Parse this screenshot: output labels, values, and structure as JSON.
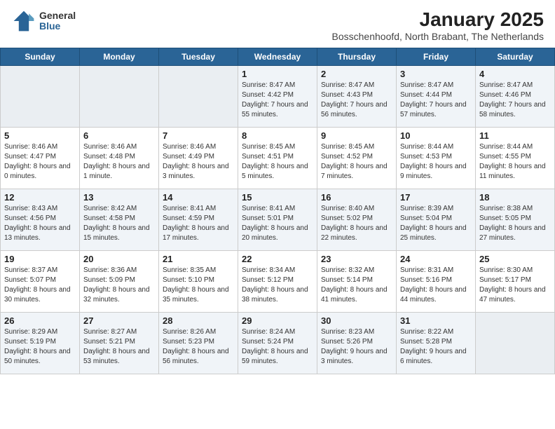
{
  "logo": {
    "general": "General",
    "blue": "Blue"
  },
  "title": "January 2025",
  "subtitle": "Bosschenhoofd, North Brabant, The Netherlands",
  "days_of_week": [
    "Sunday",
    "Monday",
    "Tuesday",
    "Wednesday",
    "Thursday",
    "Friday",
    "Saturday"
  ],
  "weeks": [
    [
      {
        "day": "",
        "info": ""
      },
      {
        "day": "",
        "info": ""
      },
      {
        "day": "",
        "info": ""
      },
      {
        "day": "1",
        "info": "Sunrise: 8:47 AM\nSunset: 4:42 PM\nDaylight: 7 hours and 55 minutes."
      },
      {
        "day": "2",
        "info": "Sunrise: 8:47 AM\nSunset: 4:43 PM\nDaylight: 7 hours and 56 minutes."
      },
      {
        "day": "3",
        "info": "Sunrise: 8:47 AM\nSunset: 4:44 PM\nDaylight: 7 hours and 57 minutes."
      },
      {
        "day": "4",
        "info": "Sunrise: 8:47 AM\nSunset: 4:46 PM\nDaylight: 7 hours and 58 minutes."
      }
    ],
    [
      {
        "day": "5",
        "info": "Sunrise: 8:46 AM\nSunset: 4:47 PM\nDaylight: 8 hours and 0 minutes."
      },
      {
        "day": "6",
        "info": "Sunrise: 8:46 AM\nSunset: 4:48 PM\nDaylight: 8 hours and 1 minute."
      },
      {
        "day": "7",
        "info": "Sunrise: 8:46 AM\nSunset: 4:49 PM\nDaylight: 8 hours and 3 minutes."
      },
      {
        "day": "8",
        "info": "Sunrise: 8:45 AM\nSunset: 4:51 PM\nDaylight: 8 hours and 5 minutes."
      },
      {
        "day": "9",
        "info": "Sunrise: 8:45 AM\nSunset: 4:52 PM\nDaylight: 8 hours and 7 minutes."
      },
      {
        "day": "10",
        "info": "Sunrise: 8:44 AM\nSunset: 4:53 PM\nDaylight: 8 hours and 9 minutes."
      },
      {
        "day": "11",
        "info": "Sunrise: 8:44 AM\nSunset: 4:55 PM\nDaylight: 8 hours and 11 minutes."
      }
    ],
    [
      {
        "day": "12",
        "info": "Sunrise: 8:43 AM\nSunset: 4:56 PM\nDaylight: 8 hours and 13 minutes."
      },
      {
        "day": "13",
        "info": "Sunrise: 8:42 AM\nSunset: 4:58 PM\nDaylight: 8 hours and 15 minutes."
      },
      {
        "day": "14",
        "info": "Sunrise: 8:41 AM\nSunset: 4:59 PM\nDaylight: 8 hours and 17 minutes."
      },
      {
        "day": "15",
        "info": "Sunrise: 8:41 AM\nSunset: 5:01 PM\nDaylight: 8 hours and 20 minutes."
      },
      {
        "day": "16",
        "info": "Sunrise: 8:40 AM\nSunset: 5:02 PM\nDaylight: 8 hours and 22 minutes."
      },
      {
        "day": "17",
        "info": "Sunrise: 8:39 AM\nSunset: 5:04 PM\nDaylight: 8 hours and 25 minutes."
      },
      {
        "day": "18",
        "info": "Sunrise: 8:38 AM\nSunset: 5:05 PM\nDaylight: 8 hours and 27 minutes."
      }
    ],
    [
      {
        "day": "19",
        "info": "Sunrise: 8:37 AM\nSunset: 5:07 PM\nDaylight: 8 hours and 30 minutes."
      },
      {
        "day": "20",
        "info": "Sunrise: 8:36 AM\nSunset: 5:09 PM\nDaylight: 8 hours and 32 minutes."
      },
      {
        "day": "21",
        "info": "Sunrise: 8:35 AM\nSunset: 5:10 PM\nDaylight: 8 hours and 35 minutes."
      },
      {
        "day": "22",
        "info": "Sunrise: 8:34 AM\nSunset: 5:12 PM\nDaylight: 8 hours and 38 minutes."
      },
      {
        "day": "23",
        "info": "Sunrise: 8:32 AM\nSunset: 5:14 PM\nDaylight: 8 hours and 41 minutes."
      },
      {
        "day": "24",
        "info": "Sunrise: 8:31 AM\nSunset: 5:16 PM\nDaylight: 8 hours and 44 minutes."
      },
      {
        "day": "25",
        "info": "Sunrise: 8:30 AM\nSunset: 5:17 PM\nDaylight: 8 hours and 47 minutes."
      }
    ],
    [
      {
        "day": "26",
        "info": "Sunrise: 8:29 AM\nSunset: 5:19 PM\nDaylight: 8 hours and 50 minutes."
      },
      {
        "day": "27",
        "info": "Sunrise: 8:27 AM\nSunset: 5:21 PM\nDaylight: 8 hours and 53 minutes."
      },
      {
        "day": "28",
        "info": "Sunrise: 8:26 AM\nSunset: 5:23 PM\nDaylight: 8 hours and 56 minutes."
      },
      {
        "day": "29",
        "info": "Sunrise: 8:24 AM\nSunset: 5:24 PM\nDaylight: 8 hours and 59 minutes."
      },
      {
        "day": "30",
        "info": "Sunrise: 8:23 AM\nSunset: 5:26 PM\nDaylight: 9 hours and 3 minutes."
      },
      {
        "day": "31",
        "info": "Sunrise: 8:22 AM\nSunset: 5:28 PM\nDaylight: 9 hours and 6 minutes."
      },
      {
        "day": "",
        "info": ""
      }
    ]
  ]
}
